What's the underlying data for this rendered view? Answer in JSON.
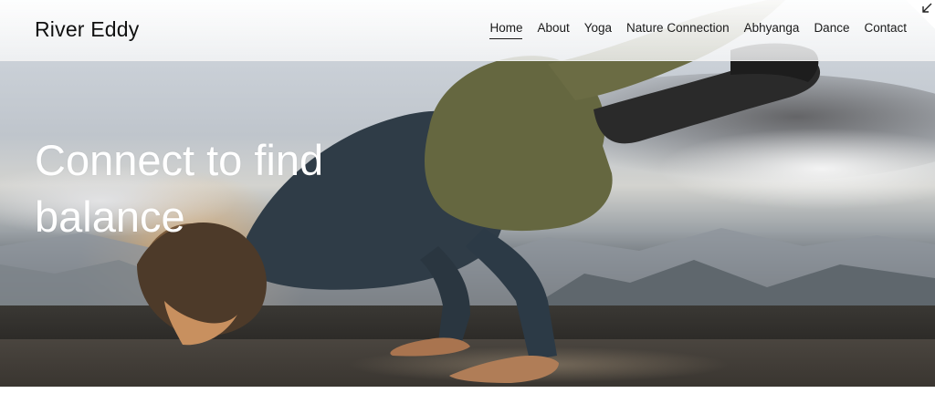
{
  "site": {
    "title": "River Eddy"
  },
  "nav": {
    "items": [
      {
        "label": "Home",
        "active": true
      },
      {
        "label": "About",
        "active": false
      },
      {
        "label": "Yoga",
        "active": false
      },
      {
        "label": "Nature Connection",
        "active": false
      },
      {
        "label": "Abhyanga",
        "active": false
      },
      {
        "label": "Dance",
        "active": false
      },
      {
        "label": "Contact",
        "active": false
      }
    ]
  },
  "hero": {
    "headline": "Connect to find balance",
    "image_subject": "person in crow yoga pose on ledge at sunrise with mountains",
    "corner_icon": "arrow-down-left-icon"
  },
  "colors": {
    "text_dark": "#111111",
    "headline": "#ffffff",
    "header_bg": "#f4f5f6",
    "page_bg": "#ffffff"
  }
}
